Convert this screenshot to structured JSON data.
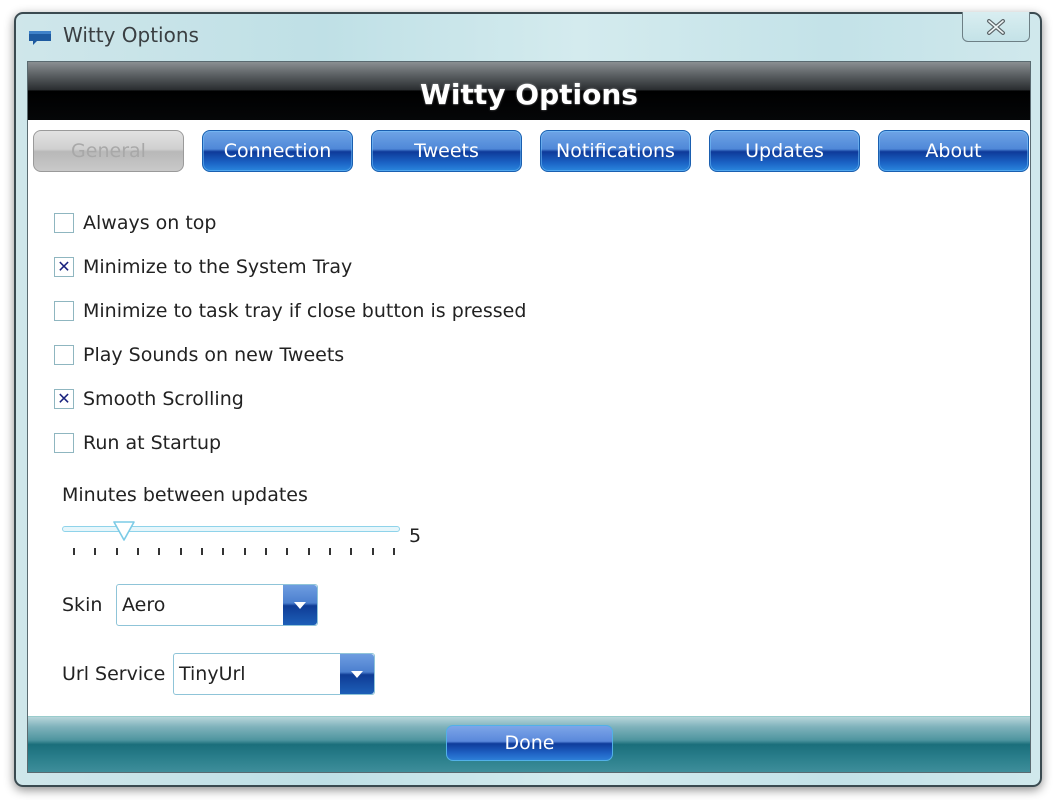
{
  "window": {
    "title": "Witty Options",
    "app_icon": "speech-bubble-icon",
    "close_icon": "close-icon"
  },
  "header": {
    "title": "Witty Options"
  },
  "tabs": [
    {
      "label": "General",
      "state": "disabled"
    },
    {
      "label": "Connection",
      "state": "normal"
    },
    {
      "label": "Tweets",
      "state": "normal"
    },
    {
      "label": "Notifications",
      "state": "normal"
    },
    {
      "label": "Updates",
      "state": "normal"
    },
    {
      "label": "About",
      "state": "normal"
    }
  ],
  "options": [
    {
      "label": "Always on top",
      "checked": false
    },
    {
      "label": "Minimize to the System Tray",
      "checked": true
    },
    {
      "label": "Minimize to task tray if close button is pressed",
      "checked": false
    },
    {
      "label": "Play Sounds on new Tweets",
      "checked": false
    },
    {
      "label": "Smooth Scrolling",
      "checked": true
    },
    {
      "label": "Run at Startup",
      "checked": false
    }
  ],
  "check_mark": "✕",
  "update_interval": {
    "label": "Minutes between updates",
    "value": "5",
    "thumb_fraction": 0.15,
    "tick_count": 16
  },
  "skin": {
    "label": "Skin",
    "value": "Aero"
  },
  "url_service": {
    "label": "Url Service",
    "value": "TinyUrl"
  },
  "footer": {
    "done_label": "Done"
  },
  "colors": {
    "tab_blue": "#1b64c6",
    "checkmark": "#1a237e",
    "footer_teal": "#1a6e7b",
    "header_black": "#000000"
  }
}
